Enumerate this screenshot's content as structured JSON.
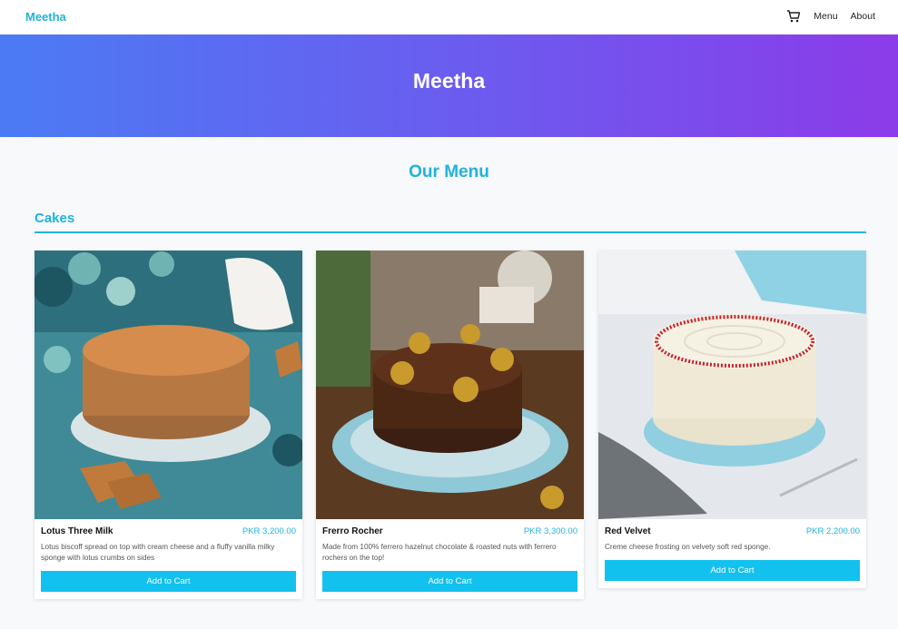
{
  "nav": {
    "brand": "Meetha",
    "cart_icon": "cart-icon",
    "links": [
      "Menu",
      "About"
    ]
  },
  "hero": {
    "title": "Meetha"
  },
  "main": {
    "title": "Our Menu",
    "sections": [
      {
        "title": "Cakes",
        "items": [
          {
            "name": "Lotus Three Milk",
            "price": "PKR 3,200.00",
            "description": "Lotus biscoff spread on top with cream cheese and a fluffy vanilla milky sponge with lotus crumbs on sides",
            "button": "Add to Cart"
          },
          {
            "name": "Frerro Rocher",
            "price": "PKR 3,300.00",
            "description": "Made from 100% ferrero hazelnut chocolate & roasted nuts with ferrero rochers on the top!",
            "button": "Add to Cart"
          },
          {
            "name": "Red Velvet",
            "price": "PKR 2,200.00",
            "description": "Creme cheese frosting on velvety soft red sponge.",
            "button": "Add to Cart"
          }
        ]
      }
    ]
  },
  "colors": {
    "accent": "#1fb3dc",
    "button": "#12c1ee",
    "hero_start": "#4b7bf4",
    "hero_end": "#8b3ce8"
  }
}
